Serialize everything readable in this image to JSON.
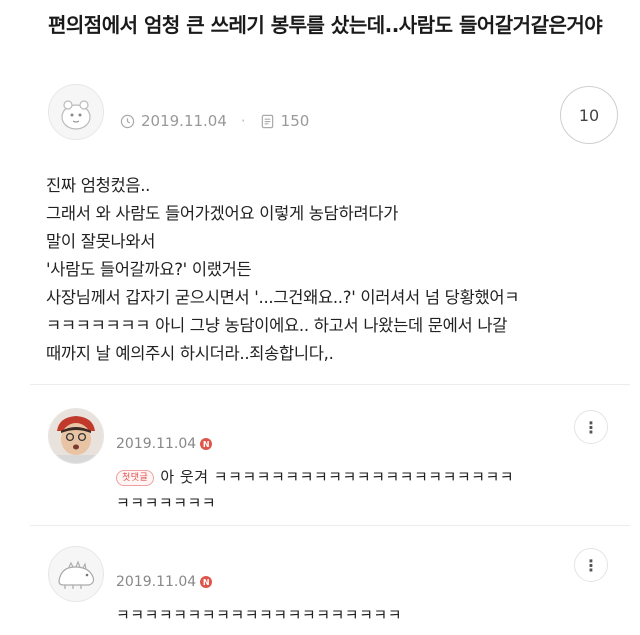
{
  "post": {
    "title": "편의점에서 엄청 큰 쓰레기 봉투를 샀는데..사람도 들어갈거같은거야",
    "date": "2019.11.04",
    "views": "150",
    "comment_count": "10",
    "body_lines": [
      "진짜 엄청컸음..",
      "그래서 와 사람도 들어가겠어요 이렇게 농담하려다가",
      "말이 잘못나와서",
      "'사람도 들어갈까요?' 이랬거든",
      "사장님께서 갑자기 굳으시면서 '...그건왜요..?' 이러셔서 넘 당황했어ㅋ",
      "ㅋㅋㅋㅋㅋㅋㅋ 아니 그냥 농담이에요.. 하고서 나왔는데 문에서 나갈",
      "때까지 날 예의주시 하시더라..죄송합니다,."
    ]
  },
  "icons": {
    "clock": "clock-icon",
    "views": "document-icon",
    "more": "more-vertical-icon",
    "new_badge": "N"
  },
  "comments": [
    {
      "date": "2019.11.04",
      "badge": "N",
      "tag": "첫댓글",
      "lines": [
        "아    웃겨 ㅋㅋㅋㅋㅋㅋㅋㅋㅋㅋㅋㅋㅋㅋㅋㅋㅋㅋㅋㅋㅋ",
        "ㅋㅋㅋㅋㅋㅋㅋ"
      ]
    },
    {
      "date": "2019.11.04",
      "badge": "N",
      "lines": [
        "ㅋㅋㅋㅋㅋㅋㅋㅋㅋㅋㅋㅋㅋㅋㅋㅋㅋㅋㅋㅋ"
      ]
    }
  ],
  "colors": {
    "badge_red": "#e0554a",
    "meta_gray": "#999999",
    "divider": "#ececec"
  }
}
